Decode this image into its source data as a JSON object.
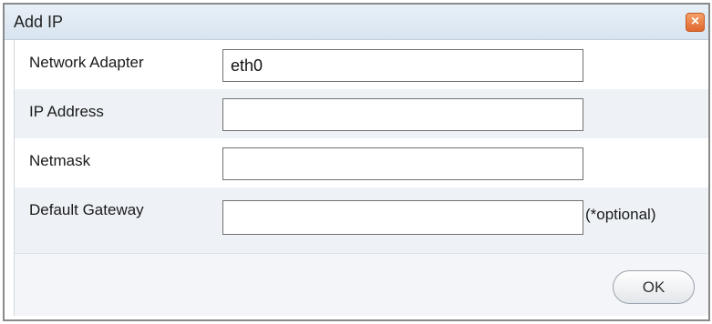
{
  "dialog": {
    "title": "Add IP",
    "close_symbol": "×"
  },
  "form": {
    "fields": [
      {
        "label": "Network Adapter",
        "value": "eth0"
      },
      {
        "label": "IP Address",
        "value": ""
      },
      {
        "label": "Netmask",
        "value": ""
      },
      {
        "label": "Default Gateway",
        "value": "",
        "hint": "(*optional)"
      }
    ]
  },
  "footer": {
    "ok_label": "OK"
  },
  "colors": {
    "close_button": "#e66e32",
    "title_bar": "#dde7f1",
    "alt_row": "#eef2f7"
  }
}
